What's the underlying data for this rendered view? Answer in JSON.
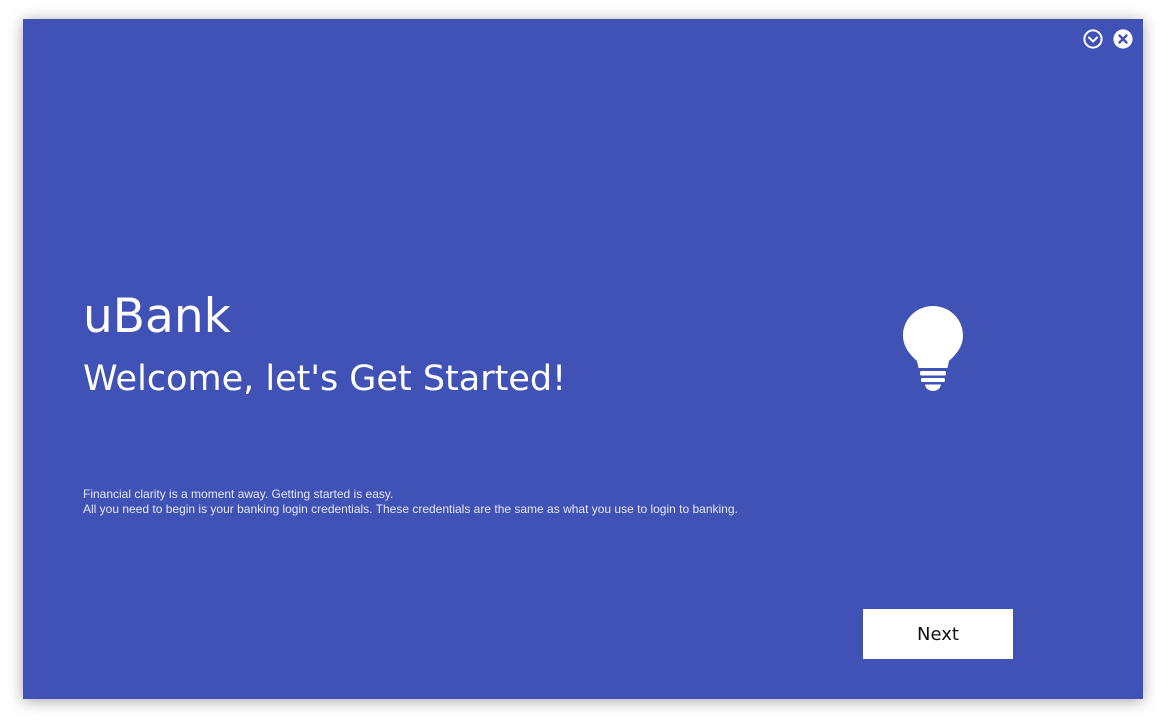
{
  "app": {
    "name": "uBank",
    "welcome": "Welcome, let's Get Started!"
  },
  "description": {
    "line1": "Financial clarity is a moment away. Getting started is easy.",
    "line2": "All you need to begin is your banking login credentials. These credentials are the same as what you use to login to banking."
  },
  "actions": {
    "next_label": "Next"
  },
  "icons": {
    "minimize": "chevron-down-circle-icon",
    "close": "close-circle-icon",
    "hero": "lightbulb-icon"
  },
  "colors": {
    "background": "#4052b6",
    "text": "#ffffff",
    "button_bg": "#ffffff",
    "button_text": "#111111"
  }
}
